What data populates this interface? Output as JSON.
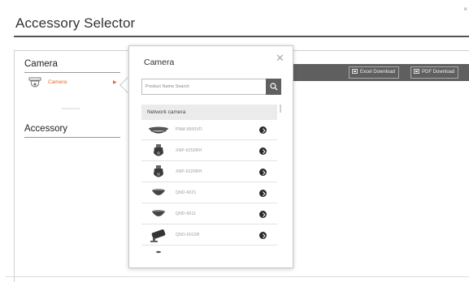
{
  "page": {
    "title": "Accessory Selector"
  },
  "left": {
    "camera_title": "Camera",
    "camera_item_label": "Camera",
    "accessory_title": "Accessory"
  },
  "toolbar": {
    "excel_label": "Excel Download",
    "pdf_label": "PDF Download"
  },
  "popup": {
    "title": "Camera",
    "search_placeholder": "Product Name Search",
    "group_header": "Network camera",
    "items": [
      {
        "model": "PNM-9000VD",
        "icon": "multi-sensor-camera"
      },
      {
        "model": "XNP-6250RH",
        "icon": "ptz-camera"
      },
      {
        "model": "XNP-6320RH",
        "icon": "ptz-camera"
      },
      {
        "model": "QND-6021",
        "icon": "dome-camera"
      },
      {
        "model": "QND-6011",
        "icon": "dome-camera"
      },
      {
        "model": "QNO-6012R",
        "icon": "bullet-camera"
      }
    ]
  },
  "colors": {
    "accent": "#e06a2a",
    "bar": "#5f5f5f",
    "group_bg": "#ebebeb"
  }
}
